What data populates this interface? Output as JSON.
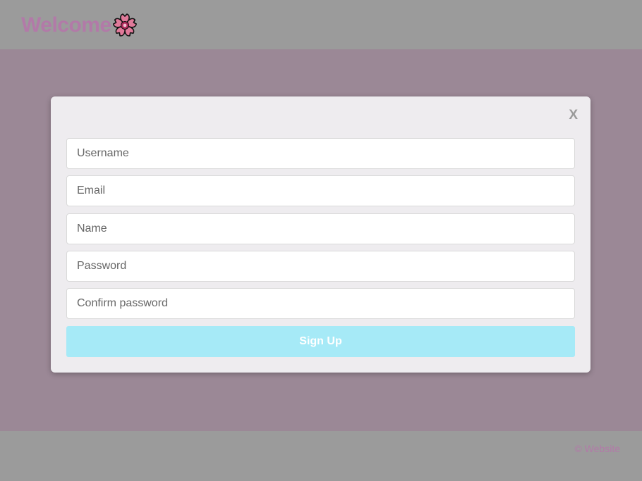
{
  "colors": {
    "header_bg": "#9b9b9b",
    "main_bg": "#9b8896",
    "modal_bg": "#eeecef",
    "brand_text": "#b27aa8",
    "button_bg": "#a6eaf7",
    "footer_bg": "#9b9b9b",
    "footer_text": "#b27aa8"
  },
  "header": {
    "title": "Welcome",
    "icon": "cherry-blossom-icon"
  },
  "modal": {
    "close_label": "X",
    "fields": {
      "username_placeholder": "Username",
      "email_placeholder": "Email",
      "name_placeholder": "Name",
      "password_placeholder": "Password",
      "confirm_password_placeholder": "Confirm password"
    },
    "submit_label": "Sign Up"
  },
  "footer": {
    "text": "© Website"
  }
}
